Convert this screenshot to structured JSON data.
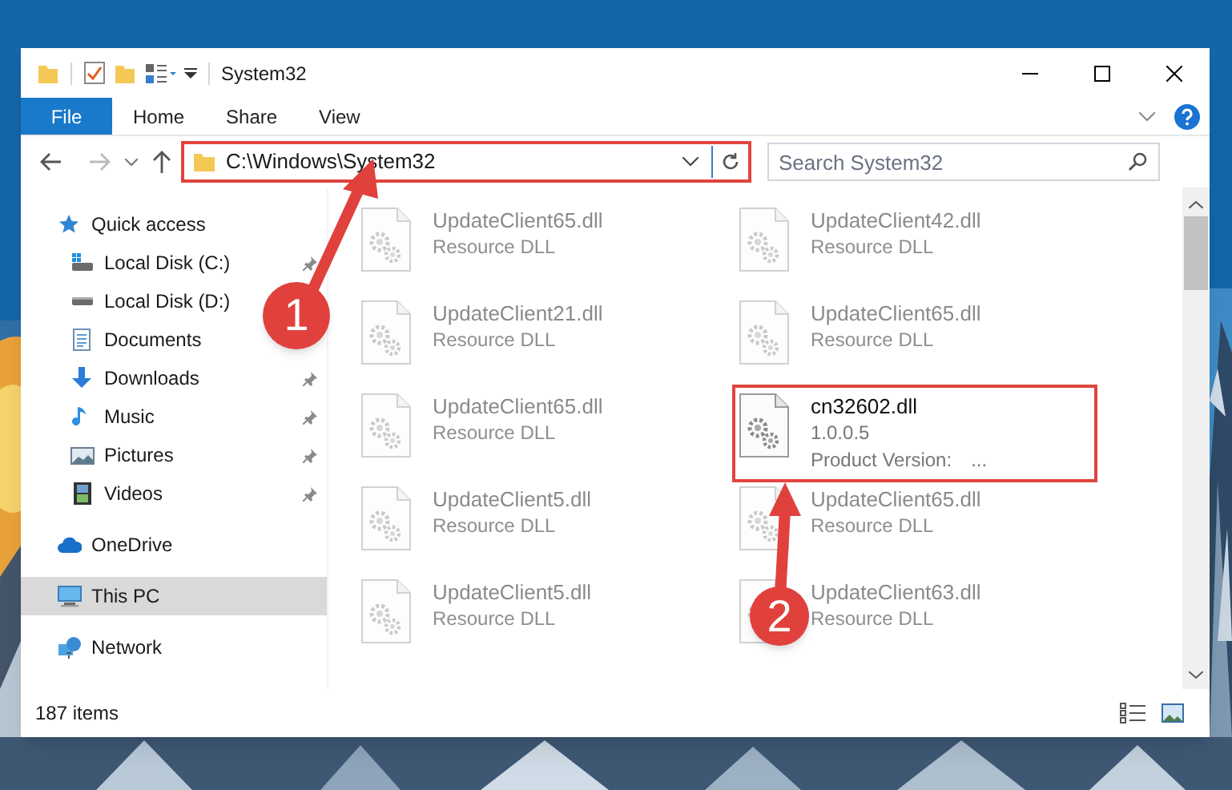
{
  "window": {
    "title": "System32"
  },
  "ribbon": {
    "tabs": [
      {
        "label": "File",
        "kind": "file",
        "selected": false
      },
      {
        "label": "Home",
        "kind": "tab",
        "selected": false
      },
      {
        "label": "Share",
        "kind": "tab",
        "selected": false
      },
      {
        "label": "View",
        "kind": "tab",
        "selected": false
      }
    ]
  },
  "address_bar": {
    "path": "C:\\Windows\\System32",
    "highlighted": true
  },
  "search": {
    "placeholder": "Search System32"
  },
  "sidebar": {
    "items": [
      {
        "label": "Quick access",
        "kind": "star",
        "selected": false,
        "children": [
          {
            "label": "Local Disk (C:)",
            "kind": "systemdrive",
            "pinned": true,
            "selected": false
          },
          {
            "label": "Local Disk (D:)",
            "kind": "drive",
            "selected": false
          },
          {
            "label": "Documents",
            "kind": "document",
            "selected": false
          },
          {
            "label": "Downloads",
            "kind": "download",
            "pinned": true,
            "selected": false
          },
          {
            "label": "Music",
            "kind": "music",
            "pinned": true,
            "selected": false
          },
          {
            "label": "Pictures",
            "kind": "pictures",
            "pinned": true,
            "selected": false
          },
          {
            "label": "Videos",
            "kind": "videos",
            "pinned": true,
            "selected": false
          }
        ]
      },
      {
        "label": "OneDrive",
        "kind": "cloud",
        "selected": false
      },
      {
        "label": "This PC",
        "kind": "pc",
        "selected": true
      },
      {
        "label": "Network",
        "kind": "network",
        "selected": false
      }
    ]
  },
  "files": [
    {
      "name": "UpdateClient65.dll",
      "subtitle": "Resource DLL",
      "blurred": true,
      "highlighted": false
    },
    {
      "name": "UpdateClient42.dll",
      "subtitle": "Resource DLL",
      "blurred": true,
      "highlighted": false
    },
    {
      "name": "UpdateClient21.dll",
      "subtitle": "Resource DLL",
      "blurred": true,
      "highlighted": false
    },
    {
      "name": "UpdateClient65.dll",
      "subtitle": "Resource DLL",
      "blurred": true,
      "highlighted": false
    },
    {
      "name": "UpdateClient65.dll",
      "subtitle": "Resource DLL",
      "blurred": true,
      "highlighted": false
    },
    {
      "name": "cn32602.dll",
      "subtitle": "1.0.0.5",
      "property_label": "Product Version:",
      "property_value": "...",
      "blurred": false,
      "highlighted": true
    },
    {
      "name": "UpdateClient5.dll",
      "subtitle": "Resource DLL",
      "blurred": true,
      "highlighted": false
    },
    {
      "name": "UpdateClient65.dll",
      "subtitle": "Resource DLL",
      "blurred": true,
      "highlighted": false
    },
    {
      "name": "UpdateClient5.dll",
      "subtitle": "Resource DLL",
      "blurred": true,
      "highlighted": false
    },
    {
      "name": "UpdateClient63.dll",
      "subtitle": "Resource DLL",
      "blurred": true,
      "highlighted": false
    }
  ],
  "status_bar": {
    "item_count": "187 items"
  },
  "annotations": [
    {
      "label": "1"
    },
    {
      "label": "2"
    }
  ]
}
